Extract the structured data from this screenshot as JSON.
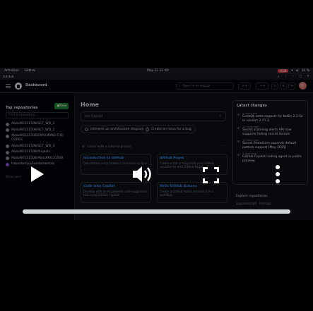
{
  "osbar": {
    "activities": "Activities",
    "app": "GitHub",
    "clock": "May 21  11:42",
    "rec": "0:00",
    "battery": "34 %"
  },
  "window": {
    "title": "GitHub",
    "controls": [
      "⌕",
      "⋮",
      "–",
      "▢",
      "✕"
    ]
  },
  "header": {
    "title": "Dashboard",
    "search_placeholder": "Type [/] to search",
    "buttons": [
      "⊙ ▾",
      "+ ▾",
      "⊙",
      "⇅",
      "✉"
    ]
  },
  "sidebar": {
    "heading": "Top repositories",
    "new_label": "New",
    "find_placeholder": "Find a repository...",
    "repos": [
      {
        "name": "Abdul90131508/SCT_WD_2",
        "color": "grey"
      },
      {
        "name": "Abdul90131508/SCT_WD_1",
        "color": "grey"
      },
      {
        "name": "Abdul90131508/EXPLORING-THE-CODES",
        "color": "grey"
      },
      {
        "name": "Abdul90131508/SCT_WD_3",
        "color": "grey"
      },
      {
        "name": "Abdul90131508/Projects",
        "color": "grey"
      },
      {
        "name": "Abdul90131508/Abdul90131508",
        "color": "grey"
      },
      {
        "name": "hakanterliyo/Fundamentals",
        "color": "purple"
      }
    ],
    "show_more": "Show more"
  },
  "main": {
    "title": "Home",
    "ask_placeholder": "Ask Copilot",
    "chips": [
      "Interpret an architecture diagram",
      "Create an issue for a bug"
    ],
    "learn_label": "Learn with a tutorial project",
    "cards": [
      {
        "title": "Introduction to GitHub",
        "desc": "Get started using GitHub in less than an hour."
      },
      {
        "title": "GitHub Pages",
        "desc": "Create a site or blog from your GitHub repositories with GitHub Pages."
      },
      {
        "title": "Code with Copilot",
        "desc": "Develop with an AI-powered code suggestion tool using GitHub Copilot."
      },
      {
        "title": "Hello GitHub Actions",
        "desc": "Create a GitHub Action and use it in a workflow."
      }
    ]
  },
  "latest": {
    "title": "Latest changes",
    "items": [
      {
        "time": "8 hours ago",
        "text": "CodeQL adds support for Kotlin 2.2.0x in version 2.21.3"
      },
      {
        "time": "11 hours ago",
        "text": "Secret scanning alerts API now supports hiding secret literals"
      },
      {
        "time": "16 hours ago",
        "text": "Secret Protection expands default pattern support (May 2025)"
      },
      {
        "time": "2 days ago",
        "text": "GitHub Copilot coding agent in public preview"
      }
    ],
    "explore_title": "Explore repositories",
    "explore_item": "gogsmooth/gt/ · Postings"
  },
  "player": {
    "progress": 1.0
  },
  "colors": {
    "accent": "#4493f8",
    "new_button": "#238636",
    "record": "#e5484d"
  }
}
